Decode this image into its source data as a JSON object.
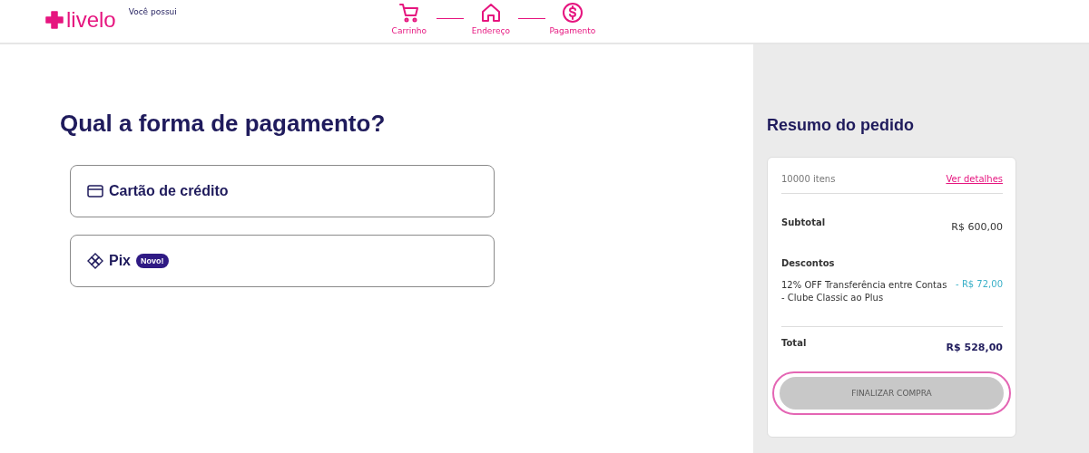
{
  "header": {
    "logo": "livelo",
    "points_label": "Você possui",
    "steps": [
      {
        "kind": "cart",
        "label": "Carrinho"
      },
      {
        "kind": "home",
        "label": "Endereço"
      },
      {
        "kind": "dollar",
        "label": "Pagamento"
      }
    ]
  },
  "main": {
    "title": "Qual a forma de pagamento?",
    "options": [
      {
        "kind": "card",
        "label": "Cartão de crédito"
      },
      {
        "kind": "pix",
        "label": "Pix",
        "badge": "Novo!"
      }
    ]
  },
  "summary": {
    "title": "Resumo do pedido",
    "items_count": "10000 itens",
    "details_link": "Ver detalhes",
    "subtotal_label": "Subtotal",
    "subtotal_value": "R$ 600,00",
    "discounts_label": "Descontos",
    "discounts": [
      {
        "label": "12% OFF Transferência entre Contas - Clube Classic ao Plus",
        "value": "- R$ 72,00"
      }
    ],
    "total_label": "Total",
    "total_value": "R$ 528,00",
    "button": {
      "label": "FINALIZAR COMPRA",
      "disabled": true,
      "highlighted": true
    }
  }
}
